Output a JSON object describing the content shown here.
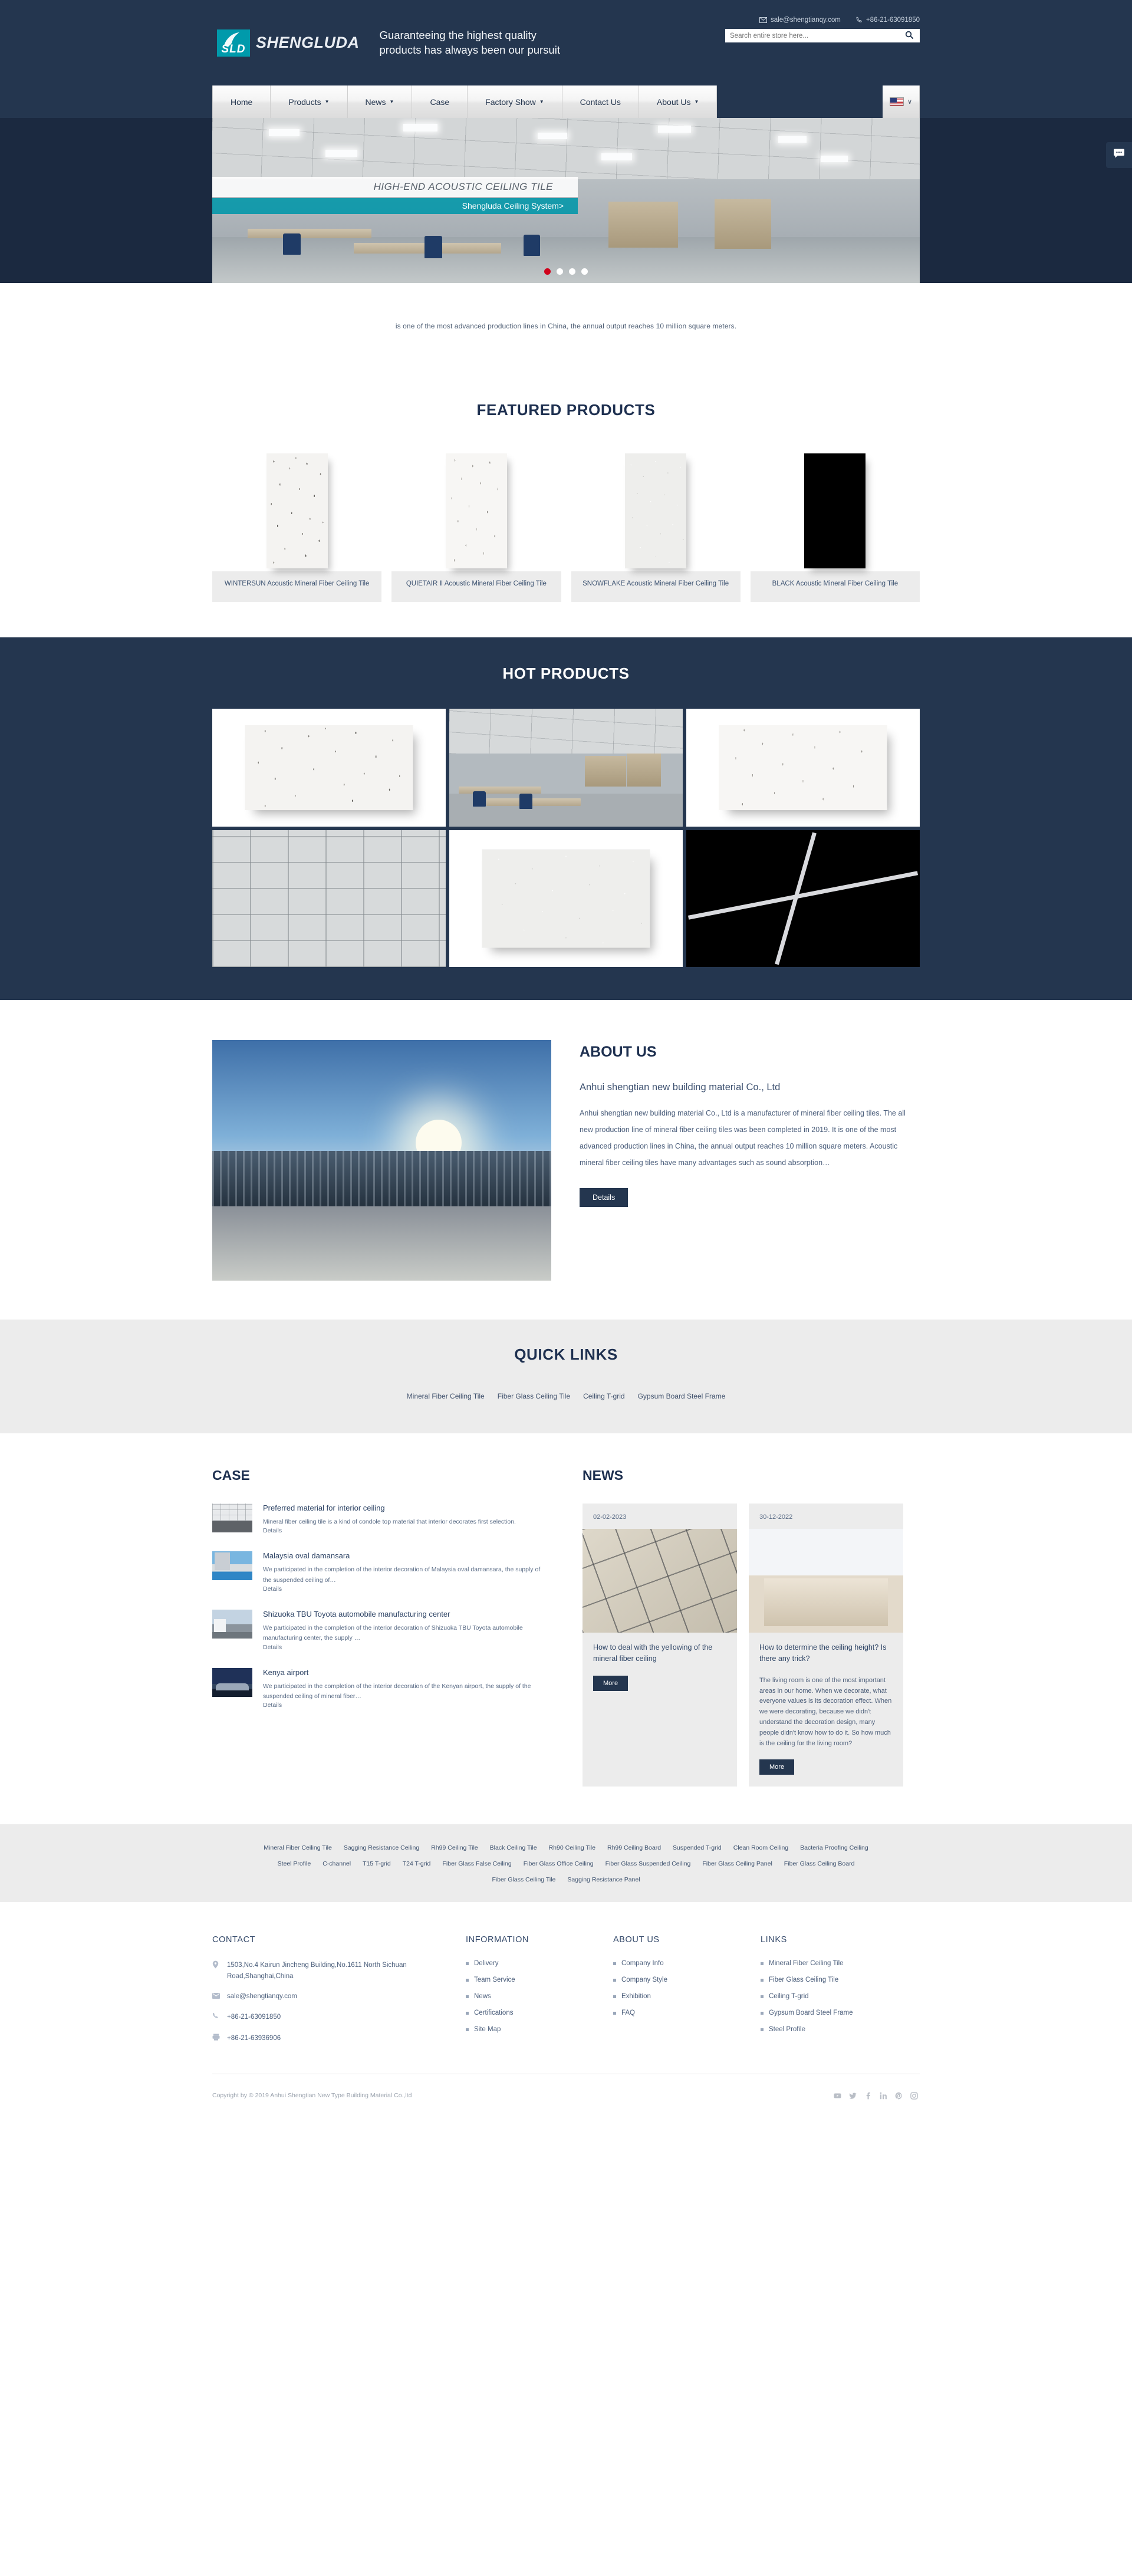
{
  "header": {
    "logo_text": "SHENGLUDA",
    "logo_mark_text": "SLD",
    "slogan": "Guaranteeing the highest quality products has always been our pursuit",
    "email": "sale@shengtianqy.com",
    "phone": "+86-21-63091850",
    "search_placeholder": "Search entire store here...",
    "search_value": ""
  },
  "nav": {
    "items": [
      {
        "label": "Home",
        "caret": false
      },
      {
        "label": "Products",
        "caret": true
      },
      {
        "label": "News",
        "caret": true
      },
      {
        "label": "Case",
        "caret": false
      },
      {
        "label": "Factory Show",
        "caret": true
      },
      {
        "label": "Contact Us",
        "caret": false
      },
      {
        "label": "About Us",
        "caret": true
      }
    ],
    "language_caret": "∨"
  },
  "hero": {
    "caption": "HIGH-END ACOUSTIC CEILING TILE",
    "subcaption": "Shengluda Ceiling System>",
    "dots": 4,
    "active_dot": 1
  },
  "intro": {
    "text": "is one of the most advanced production lines in China, the annual output reaches 10 million square meters."
  },
  "featured": {
    "title": "FEATURED PRODUCTS",
    "products": [
      {
        "name": "WINTERSUN Acoustic Mineral Fiber Ceiling Tile",
        "swatch": "wintersun"
      },
      {
        "name": "QUIETAIR Ⅱ Acoustic Mineral Fiber Ceiling Tile",
        "swatch": "quietair"
      },
      {
        "name": "SNOWFLAKE Acoustic Mineral Fiber Ceiling Tile",
        "swatch": "snowflake"
      },
      {
        "name": "BLACK Acoustic Mineral Fiber Ceiling Tile",
        "swatch": "black"
      }
    ]
  },
  "hot": {
    "title": "HOT PRODUCTS",
    "cells": [
      "wintersun-tile",
      "office-ceiling-room",
      "quietair-tile",
      "grid-ceiling-room",
      "snowflake-tile",
      "black-tgrid"
    ]
  },
  "about": {
    "title": "ABOUT US",
    "company": "Anhui shengtian new building material Co., Ltd",
    "body": "Anhui shengtian new building material Co., Ltd is a manufacturer of mineral fiber ceiling tiles. The all new production line of mineral fiber ceiling tiles was been completed in 2019. It is one of the most advanced production lines in China, the annual output reaches 10 million square meters. Acoustic mineral fiber ceiling tiles have many advantages such as sound absorption…",
    "button": "Details"
  },
  "quick": {
    "title": "QUICK LINKS",
    "links": [
      "Mineral Fiber Ceiling Tile",
      "Fiber Glass Ceiling Tile",
      "Ceiling T-grid",
      "Gypsum Board Steel Frame"
    ]
  },
  "case": {
    "title": "CASE",
    "more_label": "Details",
    "items": [
      {
        "title": "Preferred material for interior ceiling",
        "desc": "Mineral fiber ceiling tile is a kind of condole top material that interior decorates first selection."
      },
      {
        "title": "Malaysia oval damansara",
        "desc": "We participated in the completion of the interior decoration of Malaysia oval damansara, the supply of the suspended ceiling of…"
      },
      {
        "title": "Shizuoka TBU Toyota automobile manufacturing center",
        "desc": "We participated in the completion of the interior decoration of Shizuoka TBU Toyota automobile manufacturing center, the supply …"
      },
      {
        "title": "Kenya airport",
        "desc": "We participated in the completion of the interior decoration of the Kenyan airport, the supply of the suspended ceiling of mineral fiber…"
      }
    ]
  },
  "news": {
    "title": "NEWS",
    "more_label": "More",
    "items": [
      {
        "date": "02-02-2023",
        "title": "How to deal with the yellowing of the mineral fiber ceiling",
        "desc": ""
      },
      {
        "date": "30-12-2022",
        "title": "How to determine the ceiling height? Is there any trick?",
        "desc": "The living room is one of the most important areas in our home. When we decorate, what everyone values is its decoration effect. When we were decorating, because we didn't understand the decoration design, many people didn't know how to do it. So how much is the ceiling for the living room?"
      }
    ]
  },
  "tags": {
    "row1": [
      "Mineral Fiber Ceiling Tile",
      "Sagging Resistance Ceiling",
      "Rh99 Ceiling Tile",
      "Black Ceiling Tile",
      "Rh90 Ceiling Tile",
      "Rh99 Ceiling Board",
      "Suspended T-grid",
      "Clean Room Ceiling",
      "Bacteria Proofing Ceiling"
    ],
    "row2": [
      "Steel Profile",
      "C-channel",
      "T15 T-grid",
      "T24 T-grid",
      "Fiber Glass False Ceiling",
      "Fiber Glass Office Ceiling",
      "Fiber Glass Suspended Ceiling",
      "Fiber Glass Ceiling Panel",
      "Fiber Glass Ceiling Board"
    ],
    "row3": [
      "Fiber Glass Ceiling Tile",
      "Sagging Resistance Panel"
    ]
  },
  "footer": {
    "contact": {
      "heading": "CONTACT",
      "address": "1503,No.4 Kairun Jincheng Building,No.1611 North Sichuan Road,Shanghai,China",
      "email": "sale@shengtianqy.com",
      "phone": "+86-21-63091850",
      "fax": "+86-21-63936906"
    },
    "information": {
      "heading": "INFORMATION",
      "links": [
        "Delivery",
        "Team Service",
        "News",
        "Certifications",
        "Site Map"
      ]
    },
    "about": {
      "heading": "ABOUT US",
      "links": [
        "Company Info",
        "Company Style",
        "Exhibition",
        "FAQ"
      ]
    },
    "links": {
      "heading": "LINKS",
      "links": [
        "Mineral Fiber Ceiling Tile",
        "Fiber Glass Ceiling Tile",
        "Ceiling T-grid",
        "Gypsum Board Steel Frame",
        "Steel Profile"
      ]
    },
    "copyright": "Copyright by © 2019 Anhui Shengtian New Type Building Material Co.,ltd",
    "socials": [
      "youtube-icon",
      "twitter-icon",
      "facebook-icon",
      "linkedin-icon",
      "pinterest-icon",
      "instagram-icon"
    ]
  },
  "colors": {
    "brand_dark": "#24364f",
    "brand_teal": "#009aab",
    "accent_red": "#d0021b",
    "panel_grey": "#ececec"
  },
  "floating": {
    "chat": "chat-icon"
  }
}
